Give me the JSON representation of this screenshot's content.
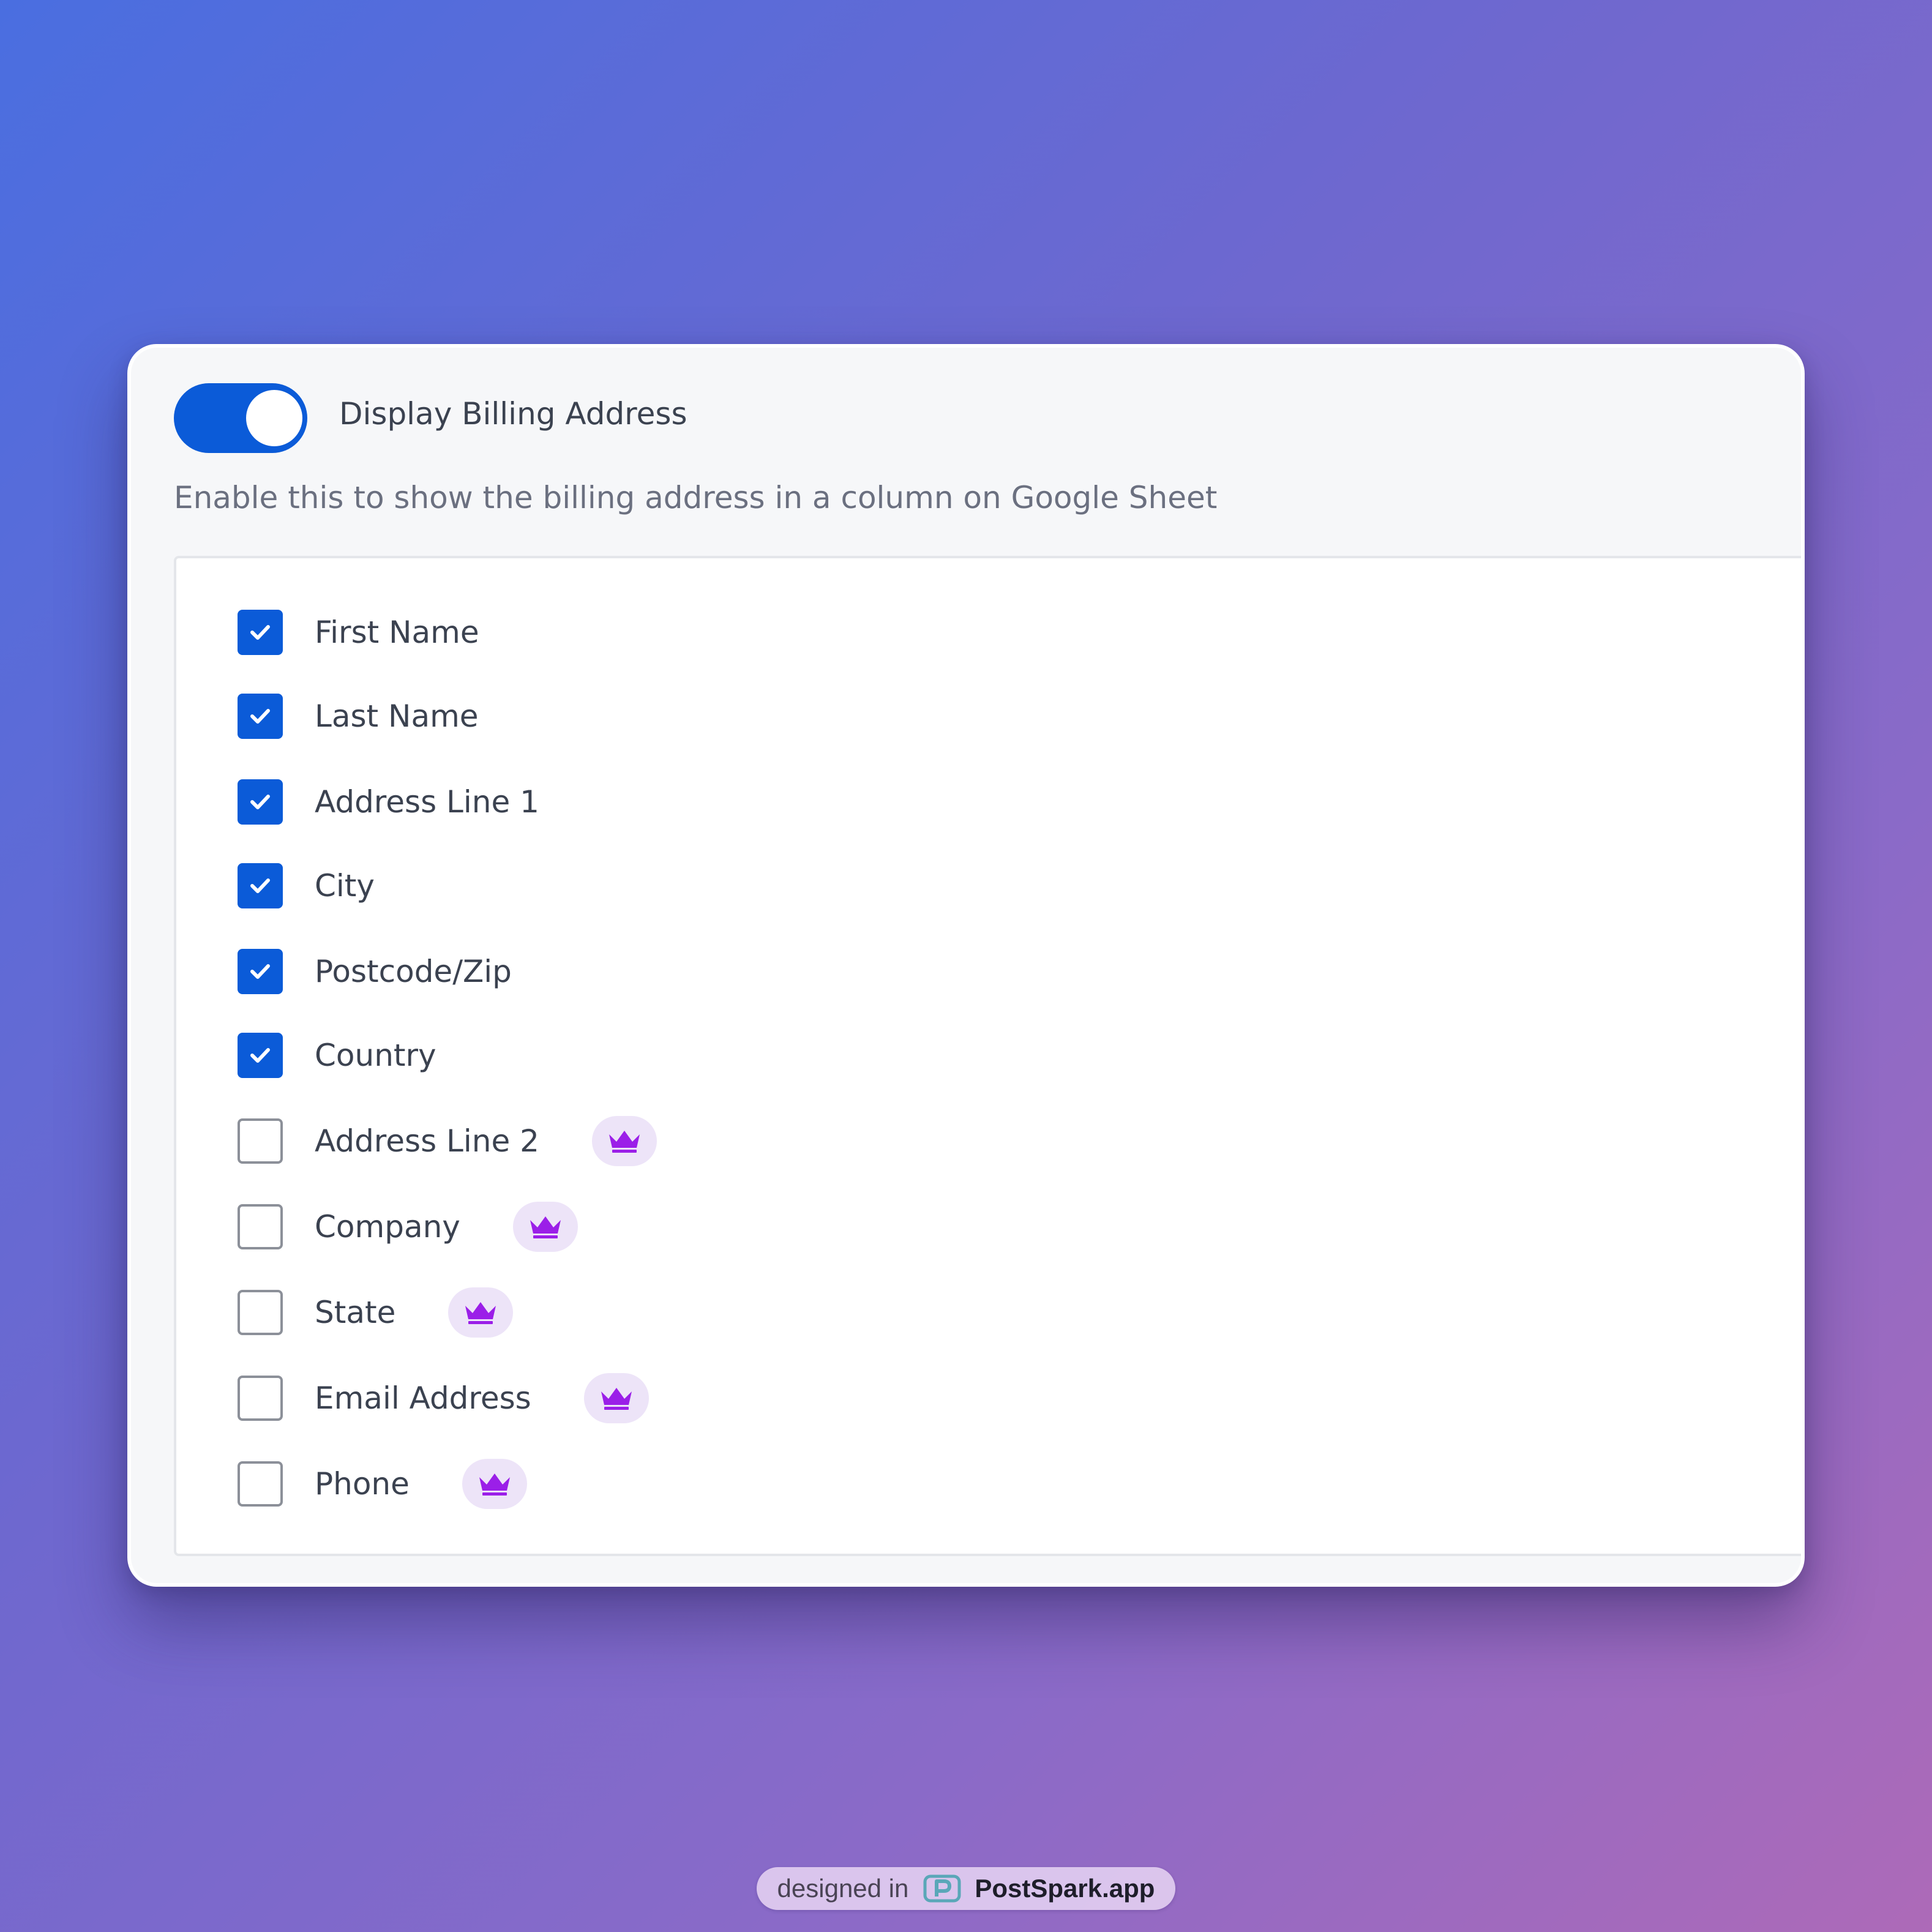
{
  "settings": {
    "toggle": {
      "label": "Display Billing Address",
      "enabled": true
    },
    "description": "Enable this to show the billing address in a column on Google Sheet"
  },
  "fields": [
    {
      "label": "First Name",
      "checked": true,
      "pro": false
    },
    {
      "label": "Last Name",
      "checked": true,
      "pro": false
    },
    {
      "label": "Address Line 1",
      "checked": true,
      "pro": false
    },
    {
      "label": "City",
      "checked": true,
      "pro": false
    },
    {
      "label": "Postcode/Zip",
      "checked": true,
      "pro": false
    },
    {
      "label": "Country",
      "checked": true,
      "pro": false
    },
    {
      "label": "Address Line 2",
      "checked": false,
      "pro": true
    },
    {
      "label": "Company",
      "checked": false,
      "pro": true
    },
    {
      "label": "State",
      "checked": false,
      "pro": true
    },
    {
      "label": "Email Address",
      "checked": false,
      "pro": true
    },
    {
      "label": "Phone",
      "checked": false,
      "pro": true
    }
  ],
  "icons": {
    "checkbox_check": "check-icon",
    "pro_badge": "crown-icon",
    "watermark_logo": "postspark-logo-icon"
  },
  "colors": {
    "accent": "#0b5bd8",
    "crown": "#9b1fe8",
    "badge_bg": "#ede4f8"
  },
  "watermark": {
    "prefix": "designed in",
    "brand": "PostSpark.app"
  }
}
